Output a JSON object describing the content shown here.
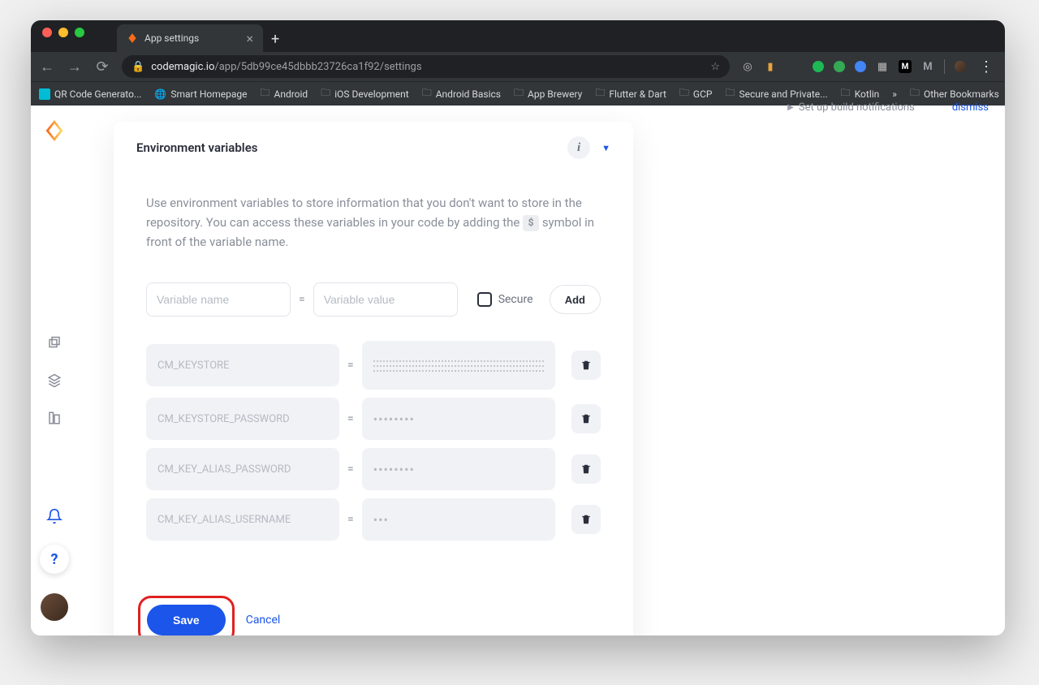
{
  "browser": {
    "tab_title": "App settings",
    "url_domain": "codemagic.io",
    "url_path": "/app/5db99ce45dbbb23726ca1f92/settings",
    "bookmarks": [
      "QR Code Generato...",
      "Smart Homepage",
      "Android",
      "iOS Development",
      "Android Basics",
      "App Brewery",
      "Flutter & Dart",
      "GCP",
      "Secure and Private...",
      "Kotlin"
    ],
    "other_bookmarks": "Other Bookmarks"
  },
  "card": {
    "title": "Environment variables",
    "desc_part1": "Use environment variables to store information that you don't want to store in the repository. You can access these variables in your code by adding the ",
    "desc_symbol": "$",
    "desc_part2": " symbol in front of the variable name.",
    "name_placeholder": "Variable name",
    "value_placeholder": "Variable value",
    "secure_label": "Secure",
    "add_label": "Add",
    "save_label": "Save",
    "cancel_label": "Cancel"
  },
  "variables": [
    {
      "name": "CM_KEYSTORE",
      "masked": "long"
    },
    {
      "name": "CM_KEYSTORE_PASSWORD",
      "masked": "••••••••"
    },
    {
      "name": "CM_KEY_ALIAS_PASSWORD",
      "masked": "••••••••"
    },
    {
      "name": "CM_KEY_ALIAS_USERNAME",
      "masked": "•••"
    }
  ],
  "side": {
    "text": "Set up build notifications",
    "dismiss": "dismiss"
  }
}
